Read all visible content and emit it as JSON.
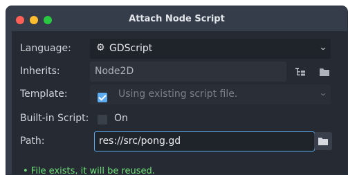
{
  "window": {
    "title": "Attach Node Script"
  },
  "form": {
    "language_label": "Language:",
    "language_value": "GDScript",
    "inherits_label": "Inherits:",
    "inherits_value": "Node2D",
    "template_label": "Template:",
    "template_checked": true,
    "template_value": "Using existing script file.",
    "builtin_label": "Built-in Script:",
    "builtin_checked": false,
    "builtin_on_label": "On",
    "path_label": "Path:",
    "path_value": "res://src/pong.gd"
  },
  "status": {
    "message": "• File exists, it will be reused."
  },
  "icons": {
    "language": "gear-icon",
    "inherits_browse_tree": "tree-icon",
    "inherits_browse_folder": "folder-icon",
    "path_browse": "folder-icon"
  },
  "colors": {
    "accent": "#5dabf1",
    "success_text": "#70e07a",
    "panel": "#262b33",
    "titlebar": "#363d4a"
  }
}
